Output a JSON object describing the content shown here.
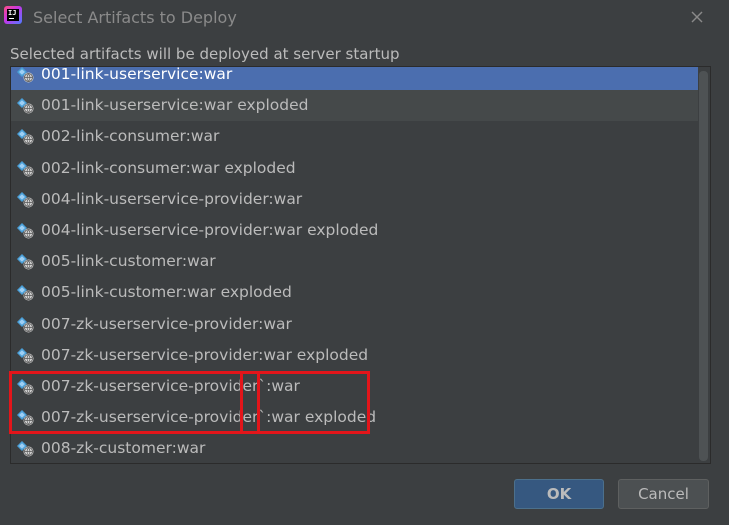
{
  "window": {
    "title": "Select Artifacts to Deploy",
    "app_icon_text": "IJ"
  },
  "subtitle": "Selected artifacts will be deployed at server startup",
  "artifacts": [
    {
      "label": "001-link-userservice:war",
      "state": "selected"
    },
    {
      "label": "001-link-userservice:war exploded",
      "state": "hover"
    },
    {
      "label": "002-link-consumer:war",
      "state": "normal"
    },
    {
      "label": "002-link-consumer:war exploded",
      "state": "normal"
    },
    {
      "label": "004-link-userservice-provider:war",
      "state": "normal"
    },
    {
      "label": "004-link-userservice-provider:war exploded",
      "state": "normal"
    },
    {
      "label": "005-link-customer:war",
      "state": "normal"
    },
    {
      "label": "005-link-customer:war exploded",
      "state": "normal"
    },
    {
      "label": "007-zk-userservice-provider:war",
      "state": "normal"
    },
    {
      "label": "007-zk-userservice-provider:war exploded",
      "state": "normal"
    },
    {
      "label": "007-zk-userservice-provider`:war",
      "state": "normal"
    },
    {
      "label": "007-zk-userservice-provider`:war exploded",
      "state": "normal"
    },
    {
      "label": "008-zk-customer:war",
      "state": "normal"
    }
  ],
  "buttons": {
    "ok": "OK",
    "cancel": "Cancel"
  },
  "colors": {
    "background": "#3c3f41",
    "selection": "#4b6eaf",
    "annotation": "#e3151a",
    "artifact_icon": "#4a9fd8"
  },
  "icons": {
    "app": "intellij-logo-icon",
    "close": "close-icon",
    "artifact": "artifact-icon"
  }
}
